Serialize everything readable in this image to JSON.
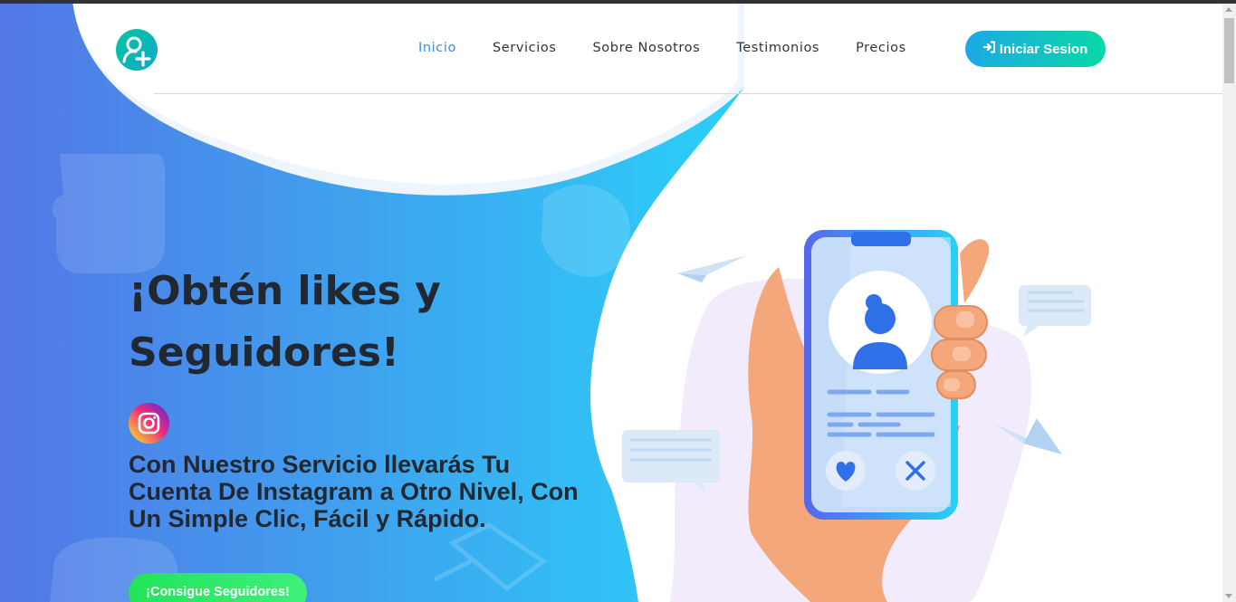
{
  "nav": {
    "logo_icon": "user-plus-icon",
    "links": [
      {
        "label": "Inicio",
        "active": true
      },
      {
        "label": "Servicios",
        "active": false
      },
      {
        "label": "Sobre Nosotros",
        "active": false
      },
      {
        "label": "Testimonios",
        "active": false
      },
      {
        "label": "Precios",
        "active": false
      }
    ],
    "login_icon": "sign-in-icon",
    "login_label": "Iniciar Sesion"
  },
  "hero": {
    "title_line1": "¡Obtén likes y",
    "title_line2": "Seguidores!",
    "social_icon": "instagram-icon",
    "subtitle": "Con Nuestro Servicio llevarás Tu Cuenta De Instagram a Otro Nivel, Con Un Simple Clic, Fácil y Rápido.",
    "cta_label": "¡Consigue Seguidores!"
  },
  "colors": {
    "hero_gradient_start": "#5277e6",
    "hero_gradient_end": "#2ad0f8",
    "nav_active": "#3b8ed8",
    "login_gradient": [
      "#1ca9e6",
      "#08d9a5"
    ],
    "cta_gradient": [
      "#22e35a",
      "#3ff07a"
    ],
    "text_dark": "#222831"
  }
}
